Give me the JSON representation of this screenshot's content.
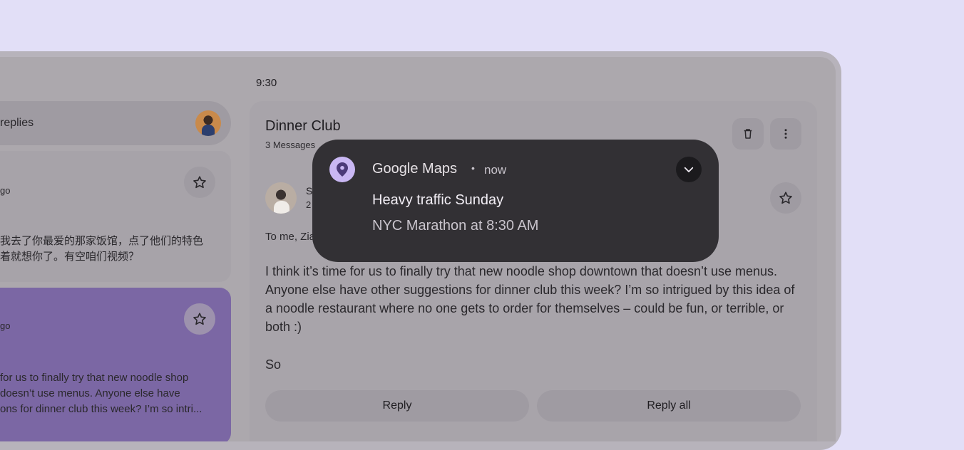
{
  "status_bar": {
    "time": "9:30"
  },
  "search": {
    "text": "replies"
  },
  "list": {
    "items": [
      {
        "time": "go",
        "body": "我去了你最爱的那家饭馆，点了他们的特色\n着就想你了。有空咱们视频？"
      },
      {
        "time": "go",
        "body": "for us to finally try that new noodle shop\ndoesn’t use menus. Anyone else have\nons for dinner club this week? I’m so intri..."
      }
    ]
  },
  "detail": {
    "subject": "Dinner Club",
    "message_count": "3 Messages",
    "sender_initial": "S",
    "sender_date": "2",
    "to_line": "To me, Zia",
    "body": "I think it’s time for us to finally try that new noodle shop downtown that doesn’t use menus. Anyone else have other suggestions for dinner club this week? I’m so intrigued by this idea of a noodle restaurant where no one gets to order for themselves – could be fun, or terrible, or both :)",
    "signoff": "So",
    "reply_label": "Reply",
    "reply_all_label": "Reply all"
  },
  "notification": {
    "app_name": "Google Maps",
    "separator": "•",
    "time": "now",
    "title": "Heavy traffic Sunday",
    "text": "NYC Marathon at 8:30 AM",
    "accent_color": "#c9b7f3",
    "icons": {
      "app": "map-pin-icon",
      "expand": "chevron-down-icon"
    }
  },
  "colors": {
    "background": "#e2dff7",
    "scrim": "#aca8ad",
    "selected_card": "#7b67a4",
    "notification_bg": "#323034"
  }
}
